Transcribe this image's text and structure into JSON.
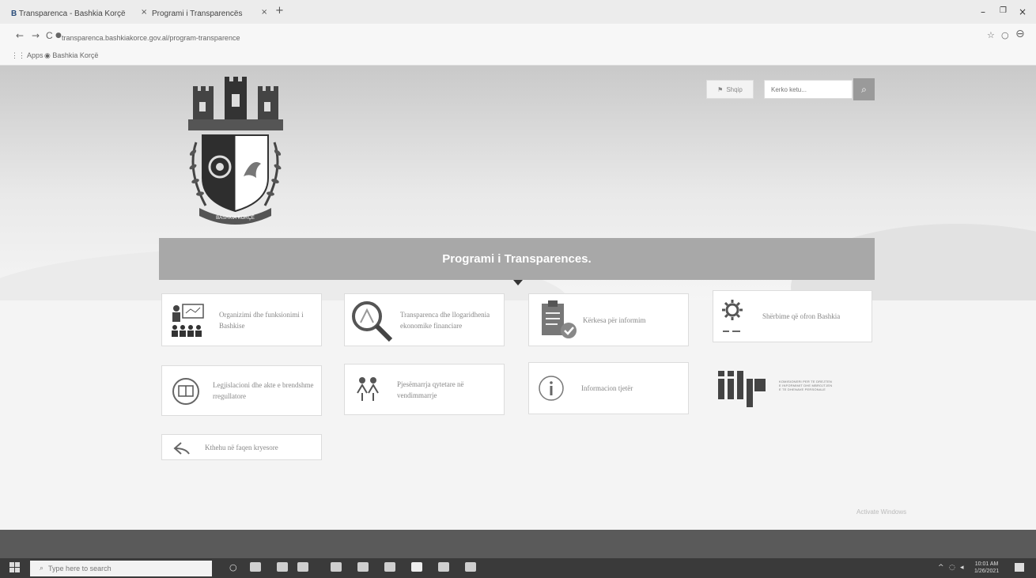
{
  "browser": {
    "tabs": [
      {
        "label": "Transparenca - Bashkia Korçë",
        "close": "×"
      },
      {
        "label": "Programi i Transparencës",
        "close": "×"
      }
    ],
    "new_tab": "+",
    "window_controls": {
      "minimize": "–",
      "maximize": "❐",
      "close": "×"
    },
    "nav": {
      "back": "←",
      "forward": "→",
      "reload": "C"
    },
    "url": "transparenca.bashkiakorce.gov.al/program-transparence",
    "bookmarks": [
      {
        "label": "Apps"
      },
      {
        "label": "Bashkia Korçë"
      }
    ],
    "profile_icon": "user-icon"
  },
  "header": {
    "lang_label": "Shqip",
    "search_placeholder": "Kerko ketu...",
    "search_icon": "search-icon"
  },
  "crest": {
    "motto": "BASHKIA KORÇË"
  },
  "banner": {
    "title": "Programi i Transparences."
  },
  "cards": [
    {
      "label": "Organizimi dhe funksionimi i Bashkise",
      "icon": "presentation-icon"
    },
    {
      "label": "Transparenca dhe llogaridhenia ekonomike financiare",
      "icon": "magnifier-icon"
    },
    {
      "label": "Kërkesa për informim",
      "icon": "clipboard-check-icon"
    },
    {
      "label": "Shërbime që ofron Bashkia",
      "icon": "gear-icon"
    },
    {
      "label": "Legjislacioni dhe akte e brendshme rregullatore",
      "icon": "law-book-icon"
    },
    {
      "label": "Pjesëmarrja qytetare në vendimmarrje",
      "icon": "people-icon"
    },
    {
      "label": "Informacion tjetër",
      "icon": "info-icon"
    },
    {
      "label": "Kthehu në faqen kryesore",
      "icon": "back-arrow-icon"
    }
  ],
  "partner": {
    "name": "idp",
    "tagline": [
      "KOMISIONERI PER TE DREJTEN",
      "E INFORMIMIT DHE MBROJTJEN",
      "E TE DHENAVE PERSONALE"
    ]
  },
  "watermark": "Activate Windows",
  "taskbar": {
    "search_placeholder": "Type here to search",
    "time": "10:01 AM",
    "date": "1/26/2021"
  }
}
